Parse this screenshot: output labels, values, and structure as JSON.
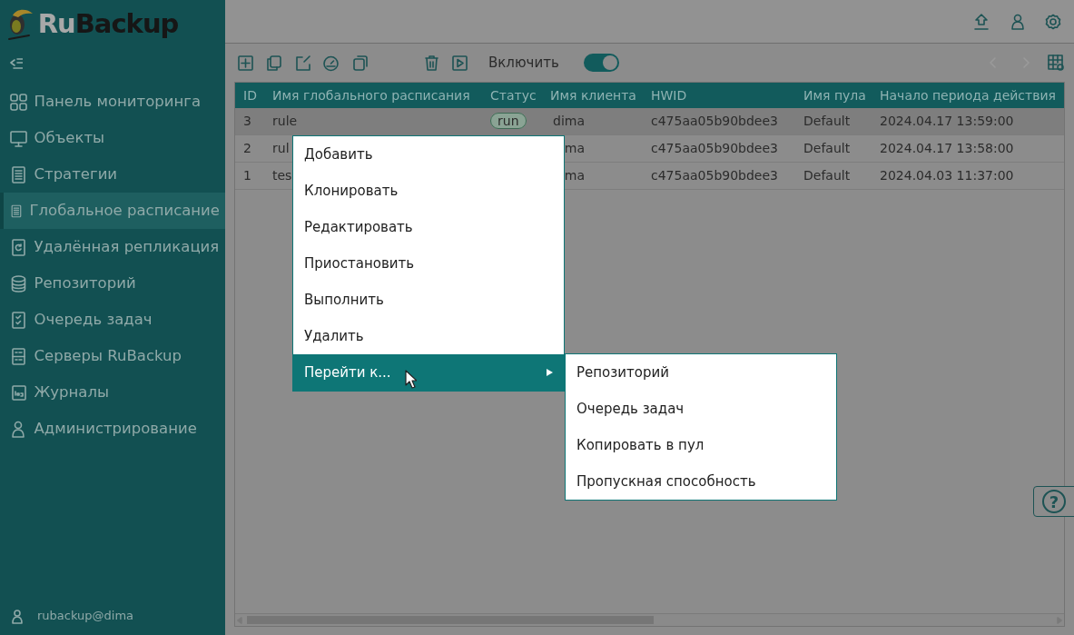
{
  "app": {
    "logo_prefix": "Ru",
    "logo_suffix": "Backup"
  },
  "sidebar": {
    "items": [
      {
        "label": "Панель мониторинга",
        "selected": false
      },
      {
        "label": "Объекты",
        "selected": false
      },
      {
        "label": "Стратегии",
        "selected": false
      },
      {
        "label": "Глобальное расписание",
        "selected": true
      },
      {
        "label": "Удалённая репликация",
        "selected": false
      },
      {
        "label": "Репозиторий",
        "selected": false
      },
      {
        "label": "Очередь задач",
        "selected": false
      },
      {
        "label": "Серверы RuBackup",
        "selected": false
      },
      {
        "label": "Журналы",
        "selected": false
      },
      {
        "label": "Администрирование",
        "selected": false
      }
    ],
    "user": "rubackup@dima"
  },
  "toolbar": {
    "toggle": {
      "label": "Включить",
      "on": true
    },
    "pager": [
      {
        "disabled": true
      },
      {
        "disabled": true
      }
    ]
  },
  "table": {
    "columns": [
      "ID",
      "Имя глобального расписания",
      "Статус",
      "Имя клиента",
      "HWID",
      "Имя пула",
      "Начало периода действия"
    ],
    "rows": [
      {
        "selected": true,
        "id": "3",
        "name": "rule",
        "status": "run",
        "client": "dima",
        "hwid": "c475aa05b90bdee3",
        "pool": "Default",
        "start": "2024.04.17 13:59:00"
      },
      {
        "selected": false,
        "id": "2",
        "name": "rul",
        "client": "ma",
        "hwid": "c475aa05b90bdee3",
        "pool": "Default",
        "start": "2024.04.17 13:58:00"
      },
      {
        "selected": false,
        "id": "1",
        "name": "tes",
        "client": "ma",
        "hwid": "c475aa05b90bdee3",
        "pool": "Default",
        "start": "2024.04.03 11:37:00"
      }
    ]
  },
  "context_menu": {
    "items": [
      {
        "label": "Добавить",
        "selected": false,
        "has_submenu": false
      },
      {
        "label": "Клонировать",
        "selected": false,
        "has_submenu": false
      },
      {
        "label": "Редактировать",
        "selected": false,
        "has_submenu": false
      },
      {
        "label": "Приостановить",
        "selected": false,
        "has_submenu": false
      },
      {
        "label": "Выполнить",
        "selected": false,
        "has_submenu": false
      },
      {
        "label": "Удалить",
        "selected": false,
        "has_submenu": false
      },
      {
        "label": "Перейти к...",
        "selected": true,
        "has_submenu": true
      }
    ],
    "submenu": [
      "Репозиторий",
      "Очередь задач",
      "Копировать в пул",
      "Пропускная способность"
    ]
  },
  "help": "?"
}
